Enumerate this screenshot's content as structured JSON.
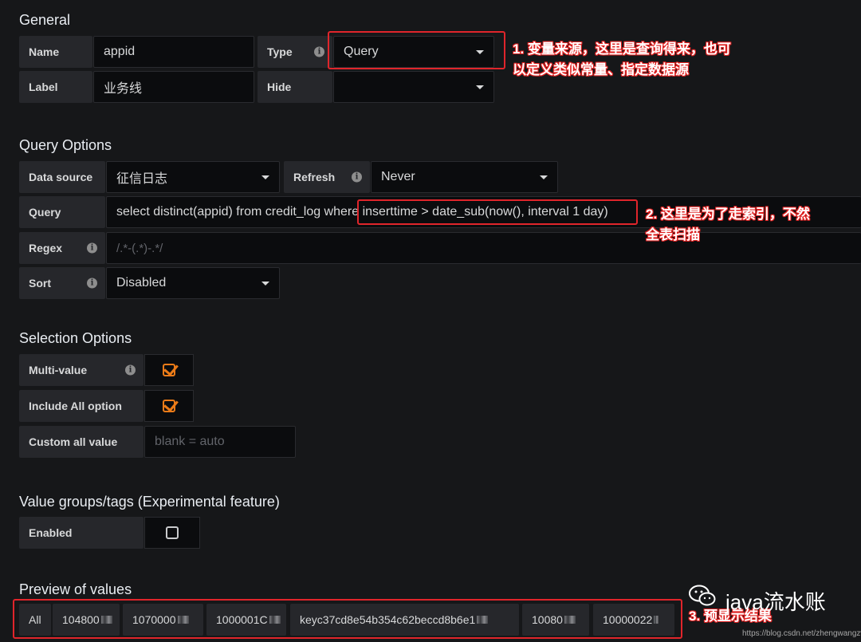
{
  "general": {
    "title": "General",
    "name_label": "Name",
    "name_value": "appid",
    "type_label": "Type",
    "type_value": "Query",
    "label_label": "Label",
    "label_value": "业务线",
    "hide_label": "Hide",
    "hide_value": ""
  },
  "query_options": {
    "title": "Query Options",
    "datasource_label": "Data source",
    "datasource_value": "征信日志",
    "refresh_label": "Refresh",
    "refresh_value": "Never",
    "query_label": "Query",
    "query_value": "select distinct(appid) from credit_log where inserttime > date_sub(now(), interval 1 day)",
    "regex_label": "Regex",
    "regex_placeholder": "/.*-(.*)-.*/",
    "sort_label": "Sort",
    "sort_value": "Disabled"
  },
  "selection_options": {
    "title": "Selection Options",
    "multi_label": "Multi-value",
    "multi_checked": true,
    "include_all_label": "Include All option",
    "include_all_checked": true,
    "custom_all_label": "Custom all value",
    "custom_all_placeholder": "blank = auto"
  },
  "value_groups": {
    "title": "Value groups/tags (Experimental feature)",
    "enabled_label": "Enabled",
    "enabled_checked": false
  },
  "preview": {
    "title": "Preview of values",
    "values": [
      "All",
      "104800",
      "1070000",
      "1000001C",
      "keyc37cd8e54b354c62beccd8b6e1",
      "10080",
      "10000022"
    ]
  },
  "annotations": {
    "a1_line1": "1. 变量来源，这里是查询得来，也可",
    "a1_line2": "以定义类似常量、指定数据源",
    "a2_line1": "2. 这里是为了走索引，不然",
    "a2_line2": "全表扫描",
    "a3": "3. 预显示结果"
  },
  "watermark": {
    "text": "java流水账",
    "credit": "https://blog.csdn.net/zhengwangzw"
  },
  "colors": {
    "background": "#161719",
    "label_bg": "#26272b",
    "input_bg": "#0b0c0e",
    "accent": "#eb7b18",
    "annotation": "#e02020"
  }
}
